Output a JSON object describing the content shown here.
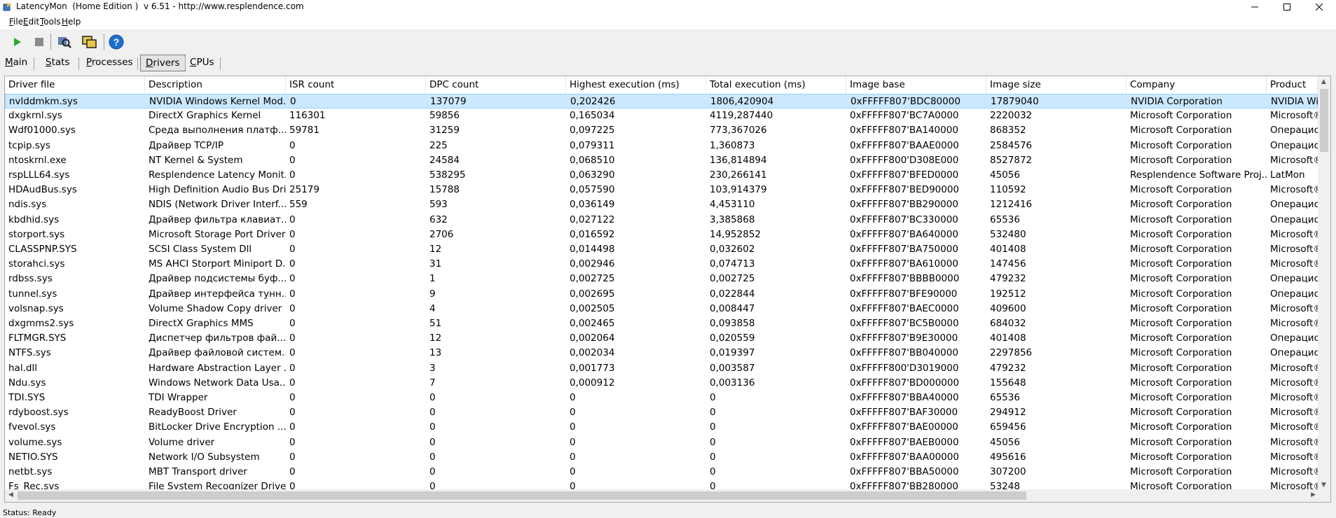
{
  "window": {
    "title": "LatencyMon  (Home Edition )  v 6.51 - http://www.resplendence.com",
    "minimize_icon": "minimize-icon",
    "maximize_icon": "maximize-icon",
    "close_icon": "close-icon"
  },
  "menu": {
    "items": [
      {
        "key": "F",
        "rest": "ile"
      },
      {
        "key": "E",
        "rest": "dit"
      },
      {
        "key": "T",
        "rest": "ools"
      },
      {
        "key": "H",
        "rest": "elp"
      }
    ]
  },
  "toolbar": {
    "buttons": [
      "play-icon",
      "stop-icon",
      "search-icon",
      "windows-icon",
      "help-icon"
    ],
    "colors": {
      "play": "#2ea82e",
      "help": "#1e6fd0"
    }
  },
  "tabs": [
    {
      "key": "M",
      "rest": "ain",
      "active": false
    },
    {
      "key": "S",
      "rest": "tats",
      "active": false
    },
    {
      "key": "P",
      "rest": "rocesses",
      "active": false
    },
    {
      "key": "D",
      "rest": "rivers",
      "active": true
    },
    {
      "key": "C",
      "rest": "PUs",
      "active": false
    }
  ],
  "table": {
    "columns": [
      "Driver file",
      "Description",
      "ISR count",
      "DPC count",
      "Highest execution (ms)",
      "Total execution (ms)",
      "Image base",
      "Image size",
      "Company",
      "Product"
    ],
    "rows": [
      [
        "nvlddmkm.sys",
        "NVIDIA Windows Kernel Mod...",
        "0",
        "137079",
        "0,202426",
        "1806,420904",
        "0xFFFFF807'BDC80000",
        "17879040",
        "NVIDIA Corporation",
        "NVIDIA Win"
      ],
      [
        "dxgkrnl.sys",
        "DirectX Graphics Kernel",
        "116301",
        "59856",
        "0,165034",
        "4119,287440",
        "0xFFFFF807'BC7A0000",
        "2220032",
        "Microsoft Corporation",
        "Microsoft®"
      ],
      [
        "Wdf01000.sys",
        "Среда выполнения платф...",
        "59781",
        "31259",
        "0,097225",
        "773,367026",
        "0xFFFFF807'BA140000",
        "868352",
        "Microsoft Corporation",
        "Операцион"
      ],
      [
        "tcpip.sys",
        "Драйвер TCP/IP",
        "0",
        "225",
        "0,079311",
        "1,360873",
        "0xFFFFF807'BAAE0000",
        "2584576",
        "Microsoft Corporation",
        "Операцион"
      ],
      [
        "ntoskrnl.exe",
        "NT Kernel & System",
        "0",
        "24584",
        "0,068510",
        "136,814894",
        "0xFFFFF800'D308E000",
        "8527872",
        "Microsoft Corporation",
        "Microsoft®"
      ],
      [
        "rspLLL64.sys",
        "Resplendence Latency Monit...",
        "0",
        "538295",
        "0,063290",
        "230,266141",
        "0xFFFFF807'BFED0000",
        "45056",
        "Resplendence Software Proj...",
        "LatMon"
      ],
      [
        "HDAudBus.sys",
        "High Definition Audio Bus Dri...",
        "25179",
        "15788",
        "0,057590",
        "103,914379",
        "0xFFFFF807'BED90000",
        "110592",
        "Microsoft Corporation",
        "Microsoft®"
      ],
      [
        "ndis.sys",
        "NDIS (Network Driver Interf...",
        "559",
        "593",
        "0,036149",
        "4,453110",
        "0xFFFFF807'BB290000",
        "1212416",
        "Microsoft Corporation",
        "Операцион"
      ],
      [
        "kbdhid.sys",
        "Драйвер фильтра клавиат...",
        "0",
        "632",
        "0,027122",
        "3,385868",
        "0xFFFFF807'BC330000",
        "65536",
        "Microsoft Corporation",
        "Операцион"
      ],
      [
        "storport.sys",
        "Microsoft Storage Port Driver",
        "0",
        "2706",
        "0,016592",
        "14,952852",
        "0xFFFFF807'BA640000",
        "532480",
        "Microsoft Corporation",
        "Microsoft®"
      ],
      [
        "CLASSPNP.SYS",
        "SCSI Class System Dll",
        "0",
        "12",
        "0,014498",
        "0,032602",
        "0xFFFFF807'BA750000",
        "401408",
        "Microsoft Corporation",
        "Microsoft®"
      ],
      [
        "storahci.sys",
        "MS AHCI Storport Miniport D...",
        "0",
        "31",
        "0,002946",
        "0,074713",
        "0xFFFFF807'BA610000",
        "147456",
        "Microsoft Corporation",
        "Microsoft®"
      ],
      [
        "rdbss.sys",
        "Драйвер подсистемы буф...",
        "0",
        "1",
        "0,002725",
        "0,002725",
        "0xFFFFF807'BBBB0000",
        "479232",
        "Microsoft Corporation",
        "Операцион"
      ],
      [
        "tunnel.sys",
        "Драйвер интерфейса тунн...",
        "0",
        "9",
        "0,002695",
        "0,022844",
        "0xFFFFF807'BFE90000",
        "192512",
        "Microsoft Corporation",
        "Операцион"
      ],
      [
        "volsnap.sys",
        "Volume Shadow Copy driver",
        "0",
        "4",
        "0,002505",
        "0,008447",
        "0xFFFFF807'BAEC0000",
        "409600",
        "Microsoft Corporation",
        "Microsoft®"
      ],
      [
        "dxgmms2.sys",
        "DirectX Graphics MMS",
        "0",
        "51",
        "0,002465",
        "0,093858",
        "0xFFFFF807'BC5B0000",
        "684032",
        "Microsoft Corporation",
        "Microsoft®"
      ],
      [
        "FLTMGR.SYS",
        "Диспетчер фильтров фай...",
        "0",
        "12",
        "0,002064",
        "0,020559",
        "0xFFFFF807'B9E30000",
        "401408",
        "Microsoft Corporation",
        "Операцион"
      ],
      [
        "NTFS.sys",
        "Драйвер файловой систем...",
        "0",
        "13",
        "0,002034",
        "0,019397",
        "0xFFFFF807'BB040000",
        "2297856",
        "Microsoft Corporation",
        "Операцион"
      ],
      [
        "hal.dll",
        "Hardware Abstraction Layer ...",
        "0",
        "3",
        "0,001773",
        "0,003587",
        "0xFFFFF800'D3019000",
        "479232",
        "Microsoft Corporation",
        "Microsoft®"
      ],
      [
        "Ndu.sys",
        "Windows Network Data Usa...",
        "0",
        "7",
        "0,000912",
        "0,003136",
        "0xFFFFF807'BD000000",
        "155648",
        "Microsoft Corporation",
        "Microsoft®"
      ],
      [
        "TDI.SYS",
        "TDI Wrapper",
        "0",
        "0",
        "0",
        "0",
        "0xFFFFF807'BBA40000",
        "65536",
        "Microsoft Corporation",
        "Microsoft®"
      ],
      [
        "rdyboost.sys",
        "ReadyBoost Driver",
        "0",
        "0",
        "0",
        "0",
        "0xFFFFF807'BAF30000",
        "294912",
        "Microsoft Corporation",
        "Microsoft®"
      ],
      [
        "fvevol.sys",
        "BitLocker Drive Encryption ...",
        "0",
        "0",
        "0",
        "0",
        "0xFFFFF807'BAE00000",
        "659456",
        "Microsoft Corporation",
        "Microsoft®"
      ],
      [
        "volume.sys",
        "Volume driver",
        "0",
        "0",
        "0",
        "0",
        "0xFFFFF807'BAEB0000",
        "45056",
        "Microsoft Corporation",
        "Microsoft®"
      ],
      [
        "NETIO.SYS",
        "Network I/O Subsystem",
        "0",
        "0",
        "0",
        "0",
        "0xFFFFF807'BAA00000",
        "495616",
        "Microsoft Corporation",
        "Microsoft®"
      ],
      [
        "netbt.sys",
        "MBT Transport driver",
        "0",
        "0",
        "0",
        "0",
        "0xFFFFF807'BBA50000",
        "307200",
        "Microsoft Corporation",
        "Microsoft®"
      ],
      [
        "Fs_Rec.sys",
        "File System Recognizer Driver",
        "0",
        "0",
        "0",
        "0",
        "0xFFFFF807'BB280000",
        "53248",
        "Microsoft Corporation",
        "Microsoft®"
      ]
    ],
    "selected_row": 0
  },
  "status": {
    "text": "Status: Ready"
  }
}
